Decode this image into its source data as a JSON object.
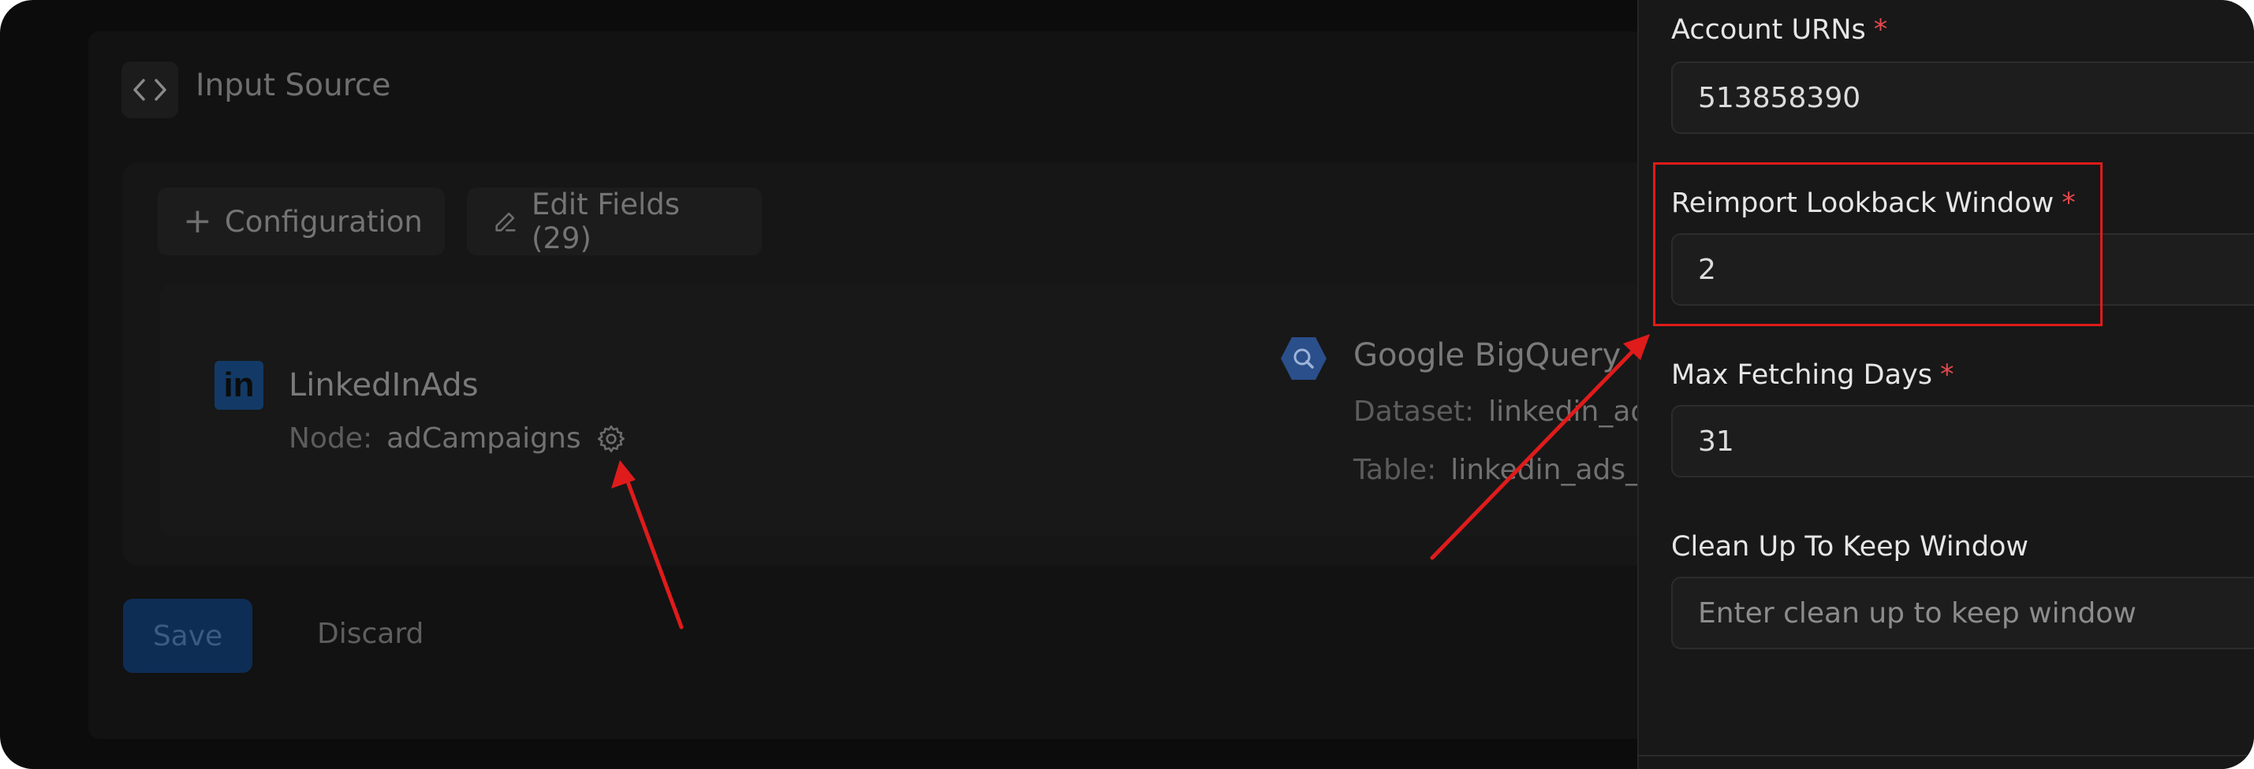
{
  "panel": {
    "title": "Input Source",
    "configuration_label": "Configuration",
    "edit_fields_label": "Edit Fields (29)"
  },
  "source": {
    "logo_text": "in",
    "name": "LinkedInAds",
    "node_label": "Node:",
    "node_value": "adCampaigns"
  },
  "destination": {
    "name": "Google BigQuery",
    "dataset_label": "Dataset:",
    "dataset_value": "linkedin_ads",
    "table_label": "Table:",
    "table_value": "linkedin_ads_a"
  },
  "actions": {
    "save_label": "Save",
    "discard_label": "Discard"
  },
  "drawer": {
    "fields": [
      {
        "label": "Account URNs",
        "required": "*",
        "value": "513858390"
      },
      {
        "label": "Reimport Lookback Window",
        "required": "*",
        "value": "2"
      },
      {
        "label": "Max Fetching Days",
        "required": "*",
        "value": "31"
      },
      {
        "label": "Clean Up To Keep Window",
        "placeholder": "Enter clean up to keep window"
      }
    ]
  },
  "colors": {
    "accent_blue": "#0e2d55",
    "required_red": "#e5484d",
    "annotation_red": "#e01b1b",
    "linkedin_blue": "#133a66",
    "bigquery_blue": "#2a4f8a"
  },
  "icons": [
    "code-icon",
    "plus-icon",
    "pencil-icon",
    "linkedin-logo-icon",
    "gear-icon",
    "bigquery-logo-icon"
  ]
}
